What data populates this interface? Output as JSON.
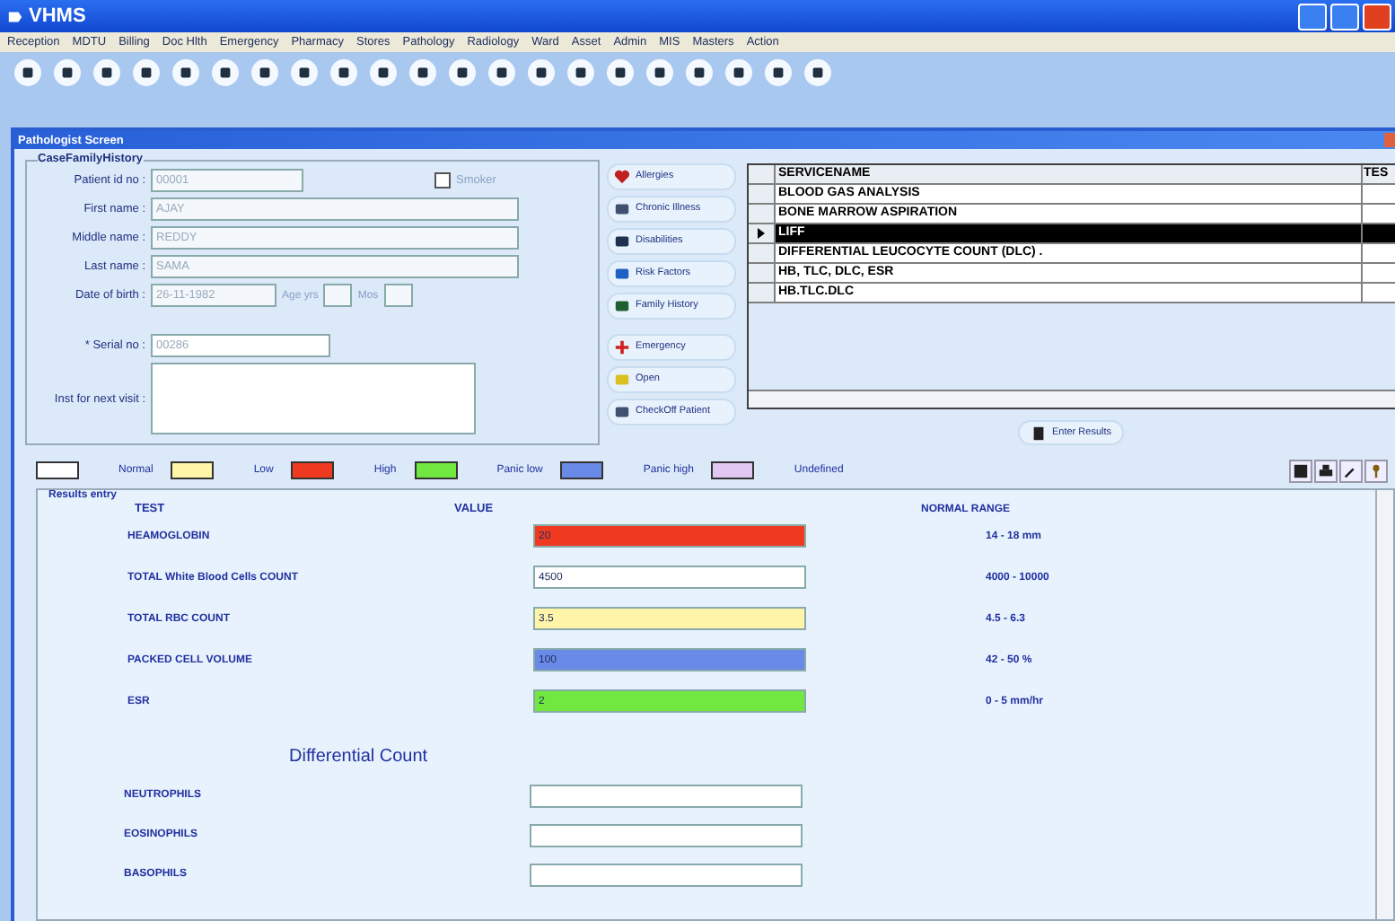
{
  "window": {
    "title": "VHMS"
  },
  "menu": [
    "Reception",
    "MDTU",
    "Billing",
    "Doc Hlth",
    "Emergency",
    "Pharmacy",
    "Stores",
    "Pathology",
    "Radiology",
    "Ward",
    "Asset",
    "Admin",
    "MIS",
    "Masters",
    "Action"
  ],
  "subwindow": {
    "title": "Pathologist Screen"
  },
  "history": {
    "group_label": "CaseFamilyHistory",
    "fields": [
      {
        "label": "Patient id no :",
        "value": "00001"
      },
      {
        "label": "First name :",
        "value": "AJAY"
      },
      {
        "label": "Middle name :",
        "value": "REDDY"
      },
      {
        "label": "Last name :",
        "value": "SAMA"
      }
    ],
    "smoker": {
      "label": "Smoker",
      "checked": false
    },
    "dob": {
      "label": "Date of birth :",
      "value": "26-11-1982",
      "age_label": "Age yrs",
      "mos_label": "Mos"
    },
    "serial": {
      "label": "* Serial no :",
      "value": "00286"
    },
    "next_visit": {
      "label": "Inst for next visit :"
    }
  },
  "side_buttons": [
    {
      "label": "Allergies",
      "kind": "heart"
    },
    {
      "label": "Chronic Illness",
      "kind": "bed"
    },
    {
      "label": "Disabilities",
      "kind": "chair"
    },
    {
      "label": "Risk Factors",
      "kind": "person"
    },
    {
      "label": "Family History",
      "kind": "family"
    },
    {
      "label": "Emergency",
      "kind": "cross"
    },
    {
      "label": "Open",
      "kind": "folder"
    },
    {
      "label": "CheckOff Patient",
      "kind": "bed"
    }
  ],
  "services": {
    "columns": [
      "SERVICENAME",
      "TES"
    ],
    "rows": [
      {
        "name": "BLOOD GAS ANALYSIS",
        "selected": false
      },
      {
        "name": "BONE MARROW ASPIRATION",
        "selected": false
      },
      {
        "name": "LIFF",
        "selected": true
      },
      {
        "name": "DIFFERENTIAL LEUCOCYTE COUNT (DLC) .",
        "selected": false
      },
      {
        "name": "HB, TLC, DLC, ESR",
        "selected": false
      },
      {
        "name": "HB.TLC.DLC",
        "selected": false
      }
    ]
  },
  "enter_results": "Enter Results",
  "legend": [
    {
      "label": "Normal",
      "color": "#ffffff"
    },
    {
      "label": "Low",
      "color": "#fff4a8"
    },
    {
      "label": "High",
      "color": "#f03a20"
    },
    {
      "label": "Panic low",
      "color": "#70e840"
    },
    {
      "label": "Panic high",
      "color": "#6a8ae8"
    },
    {
      "label": "Undefined",
      "color": "#e0c8f0"
    }
  ],
  "results": {
    "group_label": "Results entry",
    "columns": [
      "TEST",
      "VALUE",
      "NORMAL RANGE"
    ],
    "rows": [
      {
        "test": "HEAMOGLOBIN",
        "value": "20",
        "color": "#f03a20",
        "range": "14 - 18 mm"
      },
      {
        "test": "TOTAL White Blood Cells  COUNT",
        "value": "4500",
        "color": "#ffffff",
        "range": "4000 - 10000"
      },
      {
        "test": "TOTAL RBC COUNT",
        "value": "3.5",
        "color": "#fff4a8",
        "range": "4.5 - 6.3"
      },
      {
        "test": "PACKED CELL VOLUME",
        "value": "100",
        "color": "#6a8ae8",
        "range": "42 - 50 %"
      },
      {
        "test": "ESR",
        "value": "2",
        "color": "#70e840",
        "range": "0 - 5 mm/hr"
      }
    ],
    "differential_title": "Differential Count",
    "differential": [
      {
        "test": "NEUTROPHILS"
      },
      {
        "test": "EOSINOPHILS"
      },
      {
        "test": "BASOPHILS"
      }
    ]
  }
}
